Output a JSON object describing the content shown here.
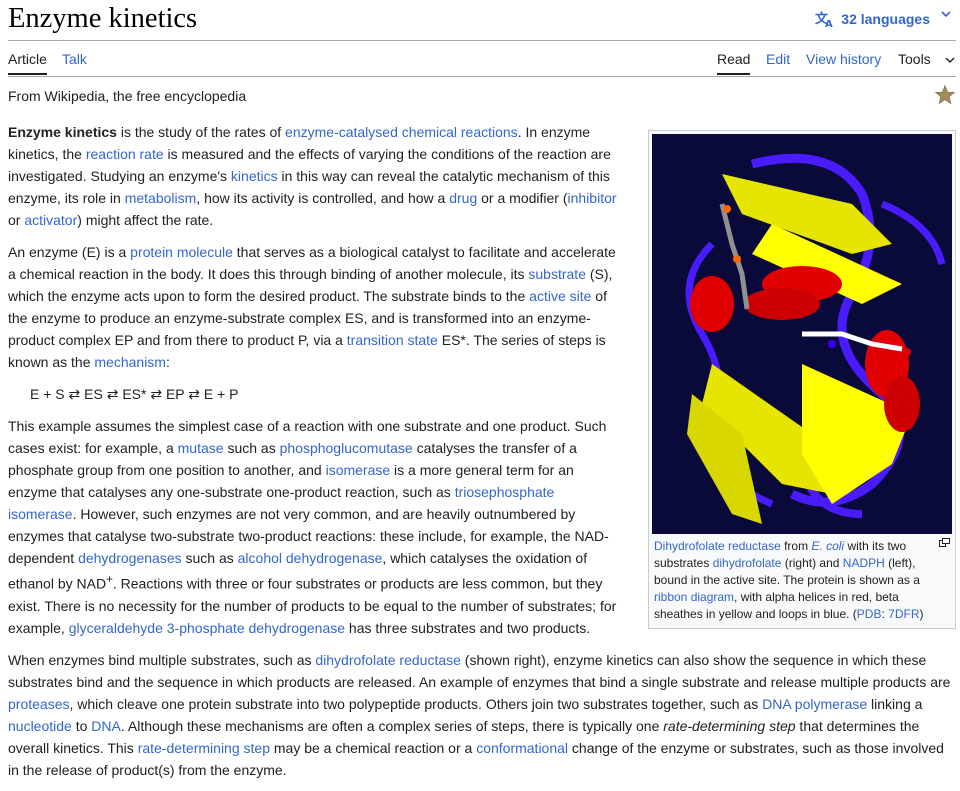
{
  "page": {
    "title": "Enzyme kinetics",
    "languages_label": "32 languages",
    "tagline": "From Wikipedia, the free encyclopedia"
  },
  "tabs": {
    "article": "Article",
    "talk": "Talk",
    "read": "Read",
    "edit": "Edit",
    "view_history": "View history",
    "tools": "Tools"
  },
  "colors": {
    "link": "#3366cc",
    "text": "#202122",
    "helix": "#e00000",
    "sheet": "#ffff00",
    "loop": "#3a00ff",
    "background": "#0a0a3a"
  },
  "icons": {
    "languages": "translate-icon",
    "star": "watchlist-star-icon",
    "enlarge": "enlarge-icon"
  },
  "para1": {
    "t1": "Enzyme kinetics",
    "t2": " is the study of the rates of ",
    "l1": "enzyme-catalysed chemical reactions",
    "t3": ". In enzyme kinetics, the ",
    "l2": "reaction rate",
    "t4": " is measured and the effects of varying the conditions of the reaction are investigated. Studying an enzyme's ",
    "l3": "kinetics",
    "t5": " in this way can reveal the catalytic mechanism of this enzyme, its role in ",
    "l4": "metabolism",
    "t6": ", how its activity is controlled, and how a ",
    "l5": "drug",
    "t7": " or a modifier (",
    "l6": "inhibitor",
    "t8": " or ",
    "l7": "activator",
    "t9": ") might affect the rate."
  },
  "para2": {
    "t1": "An enzyme (E) is a ",
    "l1": "protein molecule",
    "t2": " that serves as a biological catalyst to facilitate and accelerate a chemical reaction in the body. It does this through binding of another molecule, its ",
    "l2": "substrate",
    "t3": " (S), which the enzyme acts upon to form the desired product. The substrate binds to the ",
    "l3": "active site",
    "t4": " of the enzyme to produce an enzyme-substrate complex ES, and is transformed into an enzyme-product complex EP and from there to product P, via a ",
    "l4": "transition state",
    "t5": " ES*. The series of steps is known as the ",
    "l5": "mechanism",
    "t6": ":"
  },
  "formula": "E + S ⇄ ES ⇄ ES* ⇄ EP ⇄ E + P",
  "para3": {
    "t1": "This example assumes the simplest case of a reaction with one substrate and one product. Such cases exist: for example, a ",
    "l1": "mutase",
    "t2": " such as ",
    "l2": "phosphoglucomutase",
    "t3": " catalyses the transfer of a phosphate group from one position to another, and ",
    "l3": "isomerase",
    "t4": " is a more general term for an enzyme that catalyses any one-substrate one-product reaction, such as ",
    "l4": "triosephosphate isomerase",
    "t5": ". However, such enzymes are not very common, and are heavily outnumbered by enzymes that catalyse two-substrate two-product reactions: these include, for example, the NAD-dependent ",
    "l5": "dehydrogenases",
    "t6": " such as ",
    "l6": "alcohol dehydrogenase",
    "t7": ", which catalyses the oxidation of ethanol by NAD",
    "sup": "+",
    "t8": ". Reactions with three or four substrates or products are less common, but they exist. There is no necessity for the number of products to be equal to the number of substrates; for example, ",
    "l7": "glyceraldehyde 3-phosphate dehydrogenase",
    "t9": " has three substrates and two products."
  },
  "para4": {
    "t1": "When enzymes bind multiple substrates, such as ",
    "l1": "dihydrofolate reductase",
    "t2": " (shown right), enzyme kinetics can also show the sequence in which these substrates bind and the sequence in which products are released. An example of enzymes that bind a single substrate and release multiple products are ",
    "l2": "proteases",
    "t3": ", which cleave one protein substrate into two polypeptide products. Others join two substrates together, such as ",
    "l3": "DNA polymerase",
    "t4": " linking a ",
    "l4": "nucleotide",
    "t5": " to ",
    "l5": "DNA",
    "t6": ". Although these mechanisms are often a complex series of steps, there is typically one ",
    "i1": "rate-determining step",
    "t7": " that determines the overall kinetics. This ",
    "l6": "rate-determining step",
    "t8": " may be a chemical reaction or a ",
    "l7": "conformational",
    "t9": " change of the enzyme or substrates, such as those involved in the release of product(s) from the enzyme."
  },
  "caption": {
    "l1": "Dihydrofolate reductase",
    "t1": " from ",
    "i1": "E. coli",
    "t2": " with its two substrates ",
    "l2": "dihydrofolate",
    "t3": " (right) and ",
    "l3": "NADPH",
    "t4": " (left), bound in the active site. The protein is shown as a ",
    "l4": "ribbon diagram",
    "t5": ", with alpha helices in red, beta sheathes in yellow and loops in blue. (",
    "l5": "PDB",
    "t6": ": ",
    "l6": "7DFR",
    "t7": ")"
  }
}
